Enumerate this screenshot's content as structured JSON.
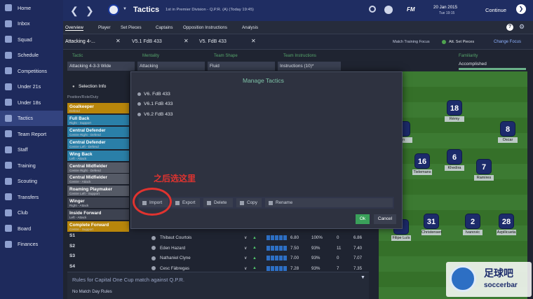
{
  "sidebar": {
    "items": [
      {
        "label": "Home"
      },
      {
        "label": "Inbox"
      },
      {
        "label": "Squad"
      },
      {
        "label": "Schedule"
      },
      {
        "label": "Competitions"
      },
      {
        "label": "Under 21s"
      },
      {
        "label": "Under 18s"
      },
      {
        "label": "Tactics"
      },
      {
        "label": "Team Report"
      },
      {
        "label": "Staff"
      },
      {
        "label": "Training"
      },
      {
        "label": "Scouting"
      },
      {
        "label": "Transfers"
      },
      {
        "label": "Club"
      },
      {
        "label": "Board"
      },
      {
        "label": "Finances"
      }
    ]
  },
  "header": {
    "title": "Tactics",
    "subtitle": "1st in Premier Division - Q.P.R. (A) (Today 19:45)",
    "fm": "FM",
    "date": "20 Jan 2015",
    "day_time": "Tue 19:15",
    "continue": "Continue"
  },
  "subnav": {
    "items": [
      "Overview",
      "Player",
      "Set Pieces",
      "Captains",
      "Opposition Instructions",
      "Analysis"
    ],
    "help": "?"
  },
  "tabs": {
    "items": [
      "Attacking 4-...",
      "V5.1 FdB 433",
      "V5. FdB 433"
    ],
    "training_focus": "Match Training Focus",
    "focus_value": "Att. Set Pieces",
    "change_focus": "Change Focus"
  },
  "tactic_bar": {
    "tactic_label": "Tactic",
    "tactic": "Attacking 4-3-3 Wide",
    "mentality_label": "Mentality",
    "mentality": "Attacking",
    "shape_label": "Team Shape",
    "shape": "Fluid",
    "instr_label": "Team Instructions",
    "instructions": "Instructions (10)*",
    "familiarity_label": "Familiarity",
    "familiarity": "Accomplished"
  },
  "selection": {
    "title": "Selection Info",
    "header": "Position/Role/Duty",
    "roles": [
      {
        "name": "Goalkeeper",
        "duty": "Defend"
      },
      {
        "name": "Full Back",
        "duty": "Right - Support"
      },
      {
        "name": "Central Defender",
        "duty": "Centre Right - Defend"
      },
      {
        "name": "Central Defender",
        "duty": "Centre Left - Defend"
      },
      {
        "name": "Wing Back",
        "duty": "Left - Attack"
      },
      {
        "name": "Central Midfielder",
        "duty": "Centre Right - Defend"
      },
      {
        "name": "Central Midfielder",
        "duty": "Centre - Attack"
      },
      {
        "name": "Roaming Playmaker",
        "duty": "Centre Left - Support"
      },
      {
        "name": "Winger",
        "duty": "Right - Attack"
      },
      {
        "name": "Inside Forward",
        "duty": "Left - Attack"
      },
      {
        "name": "Complete Forward",
        "duty": "Centre - Support"
      }
    ],
    "subs": [
      "S1",
      "S2",
      "S3",
      "S4"
    ]
  },
  "squad_rows": [
    {
      "name": "Thibaut Courtois",
      "rating": "6.80",
      "cond": "100%",
      "x": "0",
      "avg": "6.86"
    },
    {
      "name": "Eden Hazard",
      "rating": "7.50",
      "cond": "93%",
      "x": "11",
      "avg": "7.40"
    },
    {
      "name": "Nathaniel Clyne",
      "rating": "7.00",
      "cond": "93%",
      "x": "0",
      "avg": "7.07"
    },
    {
      "name": "Cesc Fàbregas",
      "rating": "7.28",
      "cond": "93%",
      "x": "7",
      "avg": "7.35"
    }
  ],
  "rules": {
    "title": "Rules for Capital One Cup match against Q.P.R.",
    "body": "No Match Day Rules"
  },
  "modal": {
    "title": "Manage Tactics",
    "tactics": [
      "V6. FdB 433",
      "V6.1 FdB 433",
      "V6.2 FdB 433"
    ],
    "buttons": {
      "import": "Import",
      "export": "Export",
      "delete": "Delete",
      "copy": "Copy",
      "rename": "Rename"
    },
    "ok": "Ok",
    "cancel": "Cancel"
  },
  "annotation": "之后选这里",
  "pitch_players": [
    {
      "num": "18",
      "name": "Rémy"
    },
    {
      "num": "8",
      "name": "Oscar"
    },
    {
      "num": "",
      "name": "an"
    },
    {
      "num": "16",
      "name": "Tielemans"
    },
    {
      "num": "6",
      "name": "Khedira"
    },
    {
      "num": "7",
      "name": "Ramires"
    },
    {
      "num": "31",
      "name": "Christensen"
    },
    {
      "num": "2",
      "name": "Ivanovic"
    },
    {
      "num": "28",
      "name": "Azpilicueta"
    },
    {
      "num": "",
      "name": "Filipe Luís"
    }
  ],
  "watermark": {
    "cn": "足球吧",
    "en": "soccerbar"
  },
  "colors": {
    "sidebar": "#1e2a5c",
    "header": "#1f2d62",
    "modal": "#2e3240",
    "ok": "#3aa05a",
    "annotation": "#e0332f"
  }
}
